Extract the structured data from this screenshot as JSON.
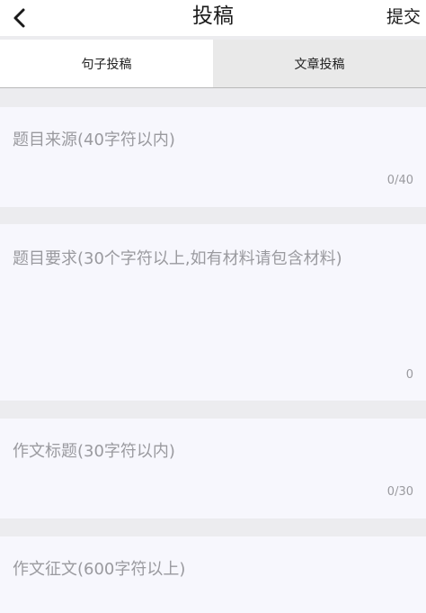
{
  "header": {
    "title": "投稿",
    "submit_label": "提交",
    "back_icon": "chevron-left-icon"
  },
  "tabs": [
    {
      "label": "句子投稿",
      "active": true
    },
    {
      "label": "文章投稿",
      "active": false
    }
  ],
  "fields": [
    {
      "name": "topic-source",
      "placeholder": "题目来源(40字符以内)",
      "counter": "0/40"
    },
    {
      "name": "topic-requirement",
      "placeholder": "题目要求(30个字符以上,如有材料请包含材料)",
      "counter": "0"
    },
    {
      "name": "essay-title",
      "placeholder": "作文标题(30字符以内)",
      "counter": "0/30"
    },
    {
      "name": "essay-body",
      "placeholder": "作文征文(600字符以上)",
      "counter": ""
    }
  ],
  "colors": {
    "background": "#ececef",
    "field_bg": "#f7f7fd",
    "placeholder": "#9a9a9f",
    "inactive_tab": "#e9e9e9"
  }
}
